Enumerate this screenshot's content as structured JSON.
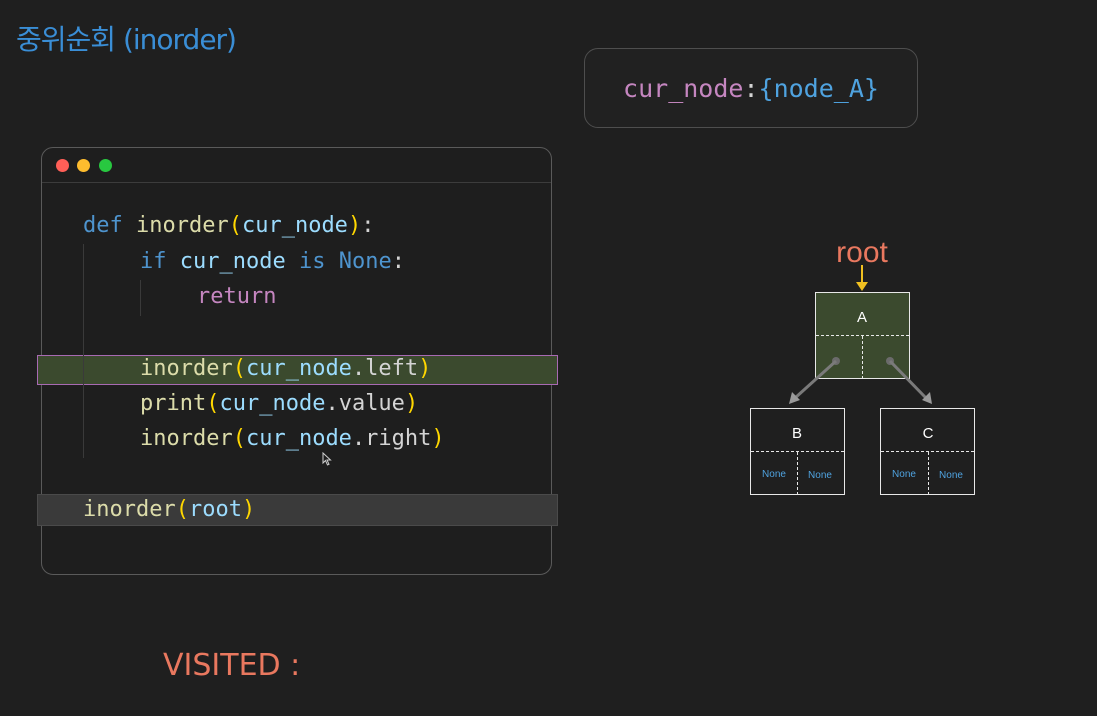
{
  "title": "중위순회 (inorder)",
  "variable": {
    "name": "cur_node",
    "separator": ":",
    "value": "{node_A}"
  },
  "code": {
    "line1": {
      "def": "def",
      "fn": "inorder",
      "open": "(",
      "arg": "cur_node",
      "close": ")",
      "colon": ":"
    },
    "line2": {
      "if": "if",
      "var": "cur_node",
      "is": "is",
      "none": "None",
      "colon": ":"
    },
    "line3": {
      "ret": "return"
    },
    "line4": {
      "fn": "inorder",
      "open": "(",
      "var": "cur_node",
      "attr": ".left",
      "close": ")"
    },
    "line5": {
      "fn": "print",
      "open": "(",
      "var": "cur_node",
      "attr": ".value",
      "close": ")"
    },
    "line6": {
      "fn": "inorder",
      "open": "(",
      "var": "cur_node",
      "attr": ".right",
      "close": ")"
    },
    "line7": {
      "fn": "inorder",
      "open": "(",
      "var": "root",
      "close": ")"
    }
  },
  "tree": {
    "root_label": "root",
    "nodes": {
      "A": {
        "label": "A"
      },
      "B": {
        "label": "B",
        "left": "None",
        "right": "None"
      },
      "C": {
        "label": "C",
        "left": "None",
        "right": "None"
      }
    },
    "colors": {
      "highlight": "#3b4a2e",
      "root_arrow": "#f0c020",
      "root_text": "#e9785f",
      "none_text": "#4fa3e0"
    }
  },
  "visited_label": "VISITED :"
}
